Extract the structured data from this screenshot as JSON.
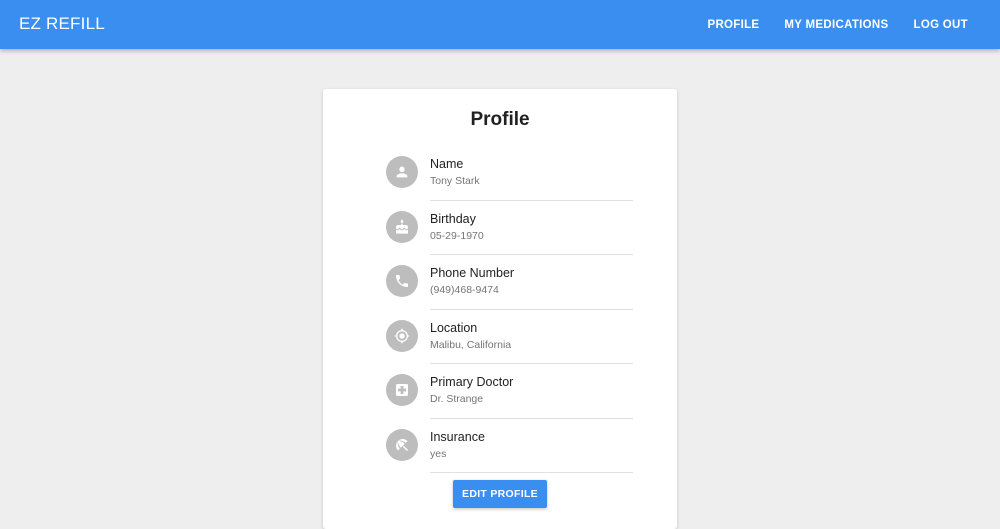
{
  "app": {
    "brand": "EZ REFILL",
    "accent_color": "#3a8ef0"
  },
  "nav": {
    "items": [
      {
        "label": "PROFILE"
      },
      {
        "label": "MY MEDICATIONS"
      },
      {
        "label": "LOG OUT"
      }
    ]
  },
  "profile": {
    "title": "Profile",
    "fields": [
      {
        "label": "Name",
        "value": "Tony Stark",
        "icon": "person-icon"
      },
      {
        "label": "Birthday",
        "value": "05-29-1970",
        "icon": "cake-icon"
      },
      {
        "label": "Phone Number",
        "value": "(949)468-9474",
        "icon": "phone-icon"
      },
      {
        "label": "Location",
        "value": "Malibu, California",
        "icon": "location-target-icon"
      },
      {
        "label": "Primary Doctor",
        "value": "Dr. Strange",
        "icon": "medical-cross-icon"
      },
      {
        "label": "Insurance",
        "value": "yes",
        "icon": "umbrella-icon"
      }
    ],
    "edit_label": "EDIT PROFILE"
  }
}
